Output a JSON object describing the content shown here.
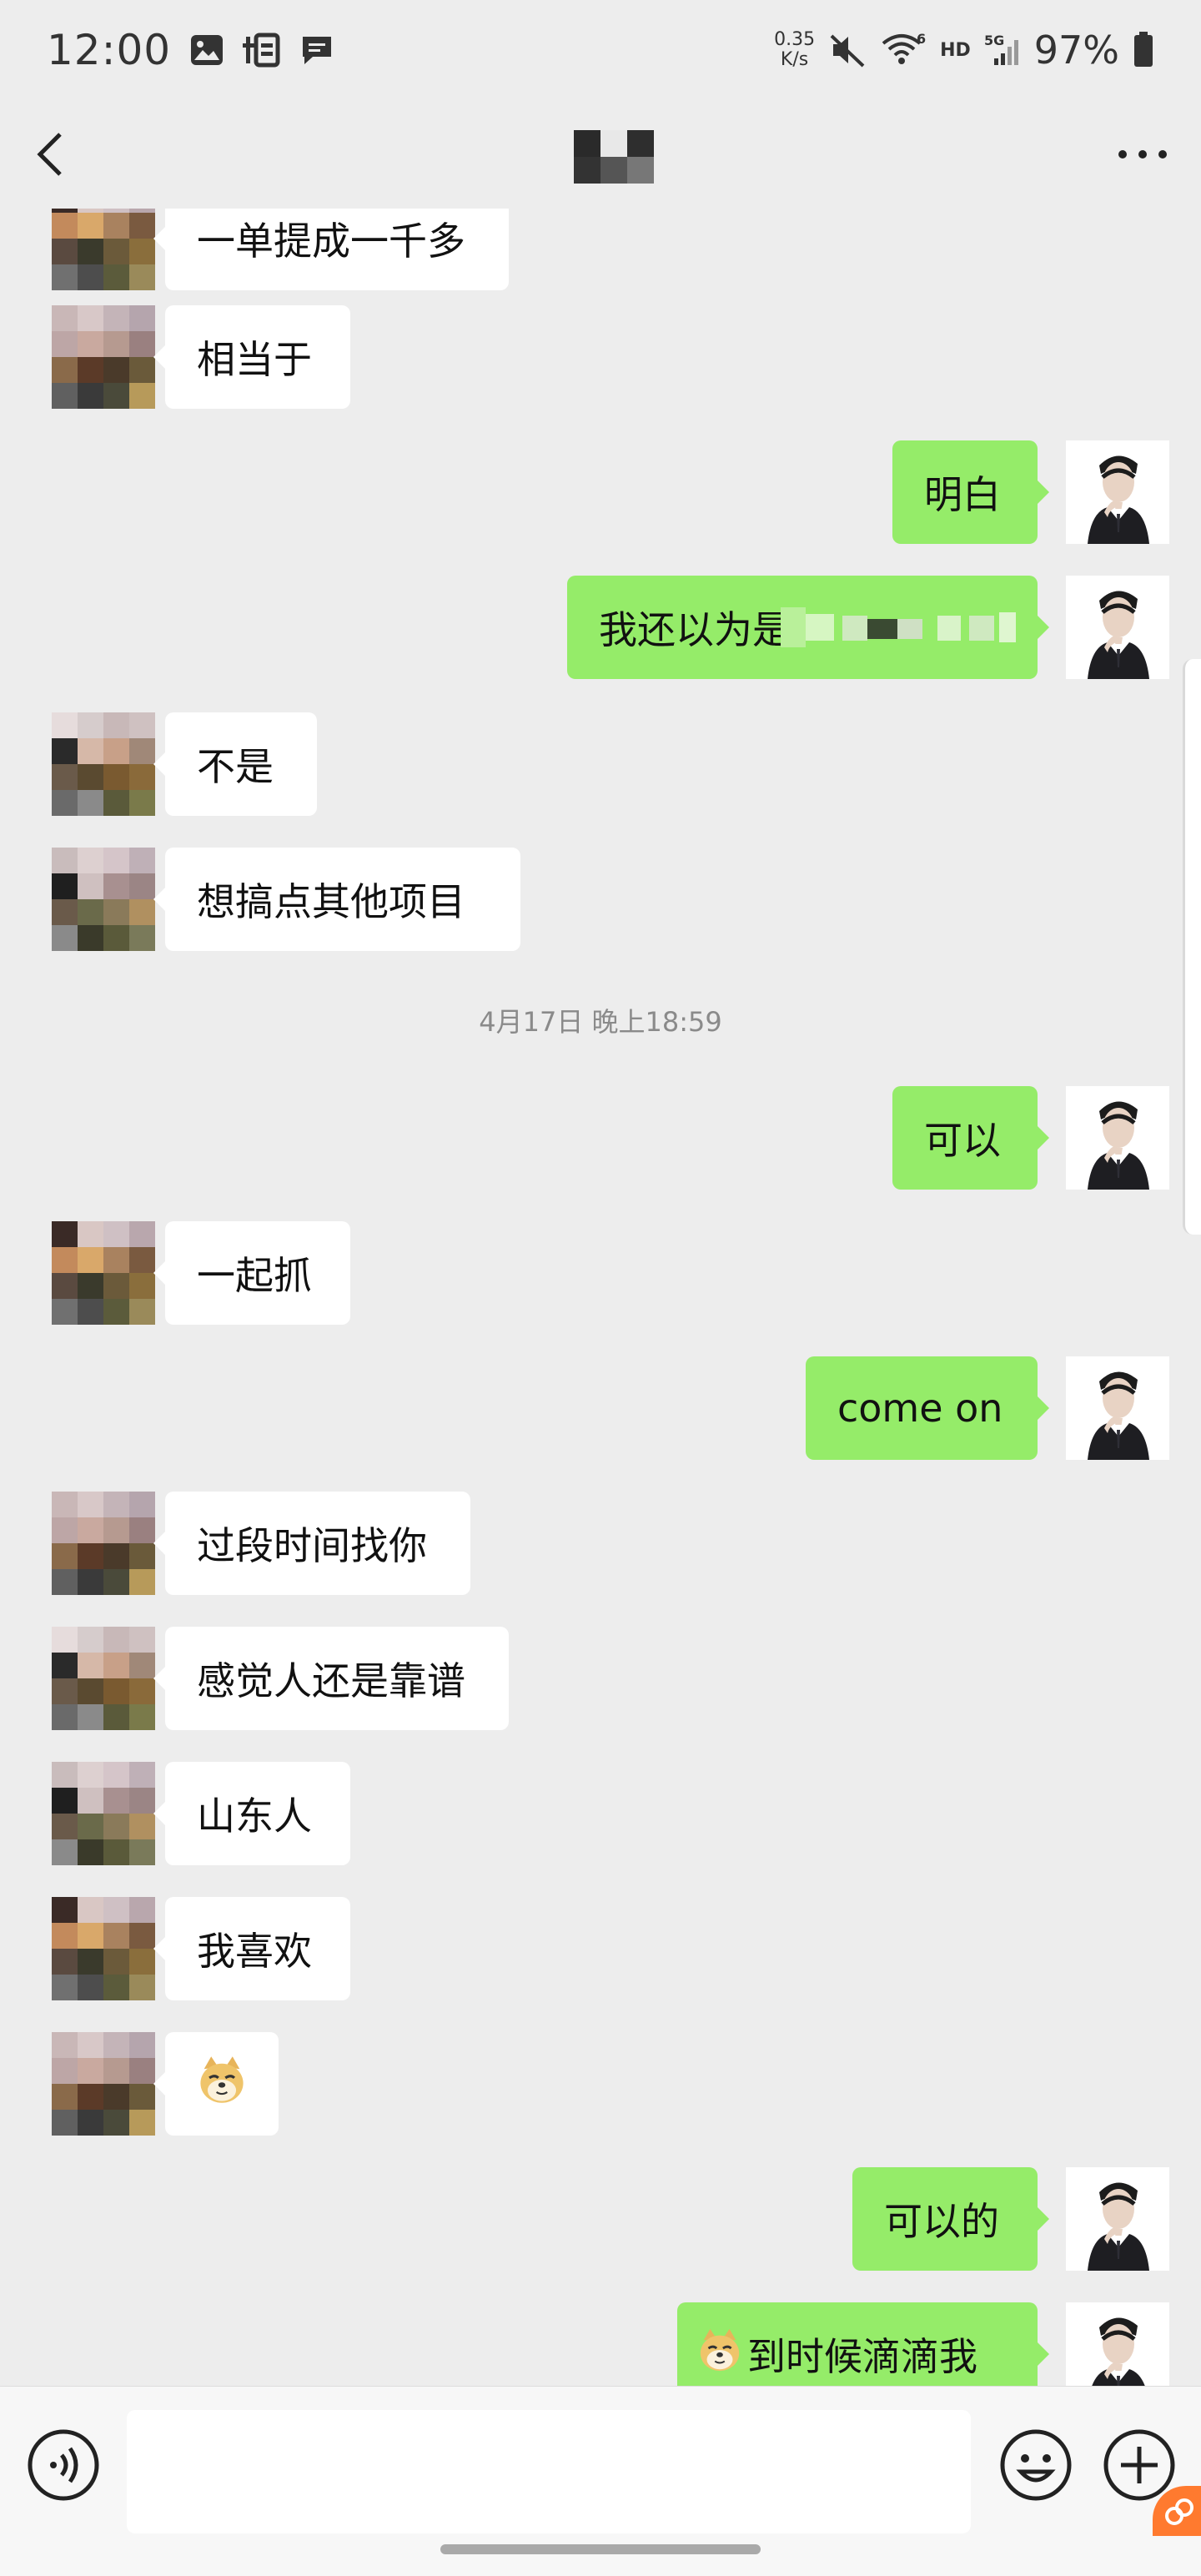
{
  "status_bar": {
    "time": "12:00",
    "net_speed_value": "0.35",
    "net_speed_unit": "K/s",
    "hd_label": "HD",
    "five_g_label": "5G",
    "wifi_sub_label": "6",
    "battery_percent": "97%",
    "icons": [
      "gallery-icon",
      "taobao-icon",
      "message-icon",
      "mute-icon",
      "wifi-icon",
      "signal-icon",
      "battery-icon"
    ]
  },
  "nav": {
    "back_icon": "chevron-left-icon",
    "more_icon": "more-dots-icon"
  },
  "messages": [
    {
      "side": "in",
      "text": "一单提成一千多"
    },
    {
      "side": "in",
      "text": "相当于"
    },
    {
      "side": "out",
      "text": "明白"
    },
    {
      "side": "out",
      "text": "我还以为是"
    },
    {
      "side": "in",
      "text": "不是"
    },
    {
      "side": "in",
      "text": "想搞点其他项目"
    },
    {
      "side": "out",
      "text": "可以"
    },
    {
      "side": "in",
      "text": "一起抓"
    },
    {
      "side": "out",
      "text": "come on"
    },
    {
      "side": "in",
      "text": "过段时间找你"
    },
    {
      "side": "in",
      "text": "感觉人还是靠谱"
    },
    {
      "side": "in",
      "text": "山东人"
    },
    {
      "side": "in",
      "text": "我喜欢"
    },
    {
      "side": "in",
      "text": "",
      "sticker": "doge-emoji"
    },
    {
      "side": "out",
      "text": "可以的"
    },
    {
      "side": "out",
      "text": "到时候滴滴我",
      "sticker": "doge-emoji"
    }
  ],
  "timestamp": "4月17日 晚上18:59",
  "input_bar": {
    "placeholder": "",
    "voice_icon": "voice-icon",
    "emoji_icon": "emoji-icon",
    "plus_icon": "plus-icon"
  },
  "colors": {
    "background": "#ededed",
    "outgoing_bubble": "#95ec69",
    "incoming_bubble": "#ffffff",
    "timestamp_text": "#8a8a8a"
  }
}
